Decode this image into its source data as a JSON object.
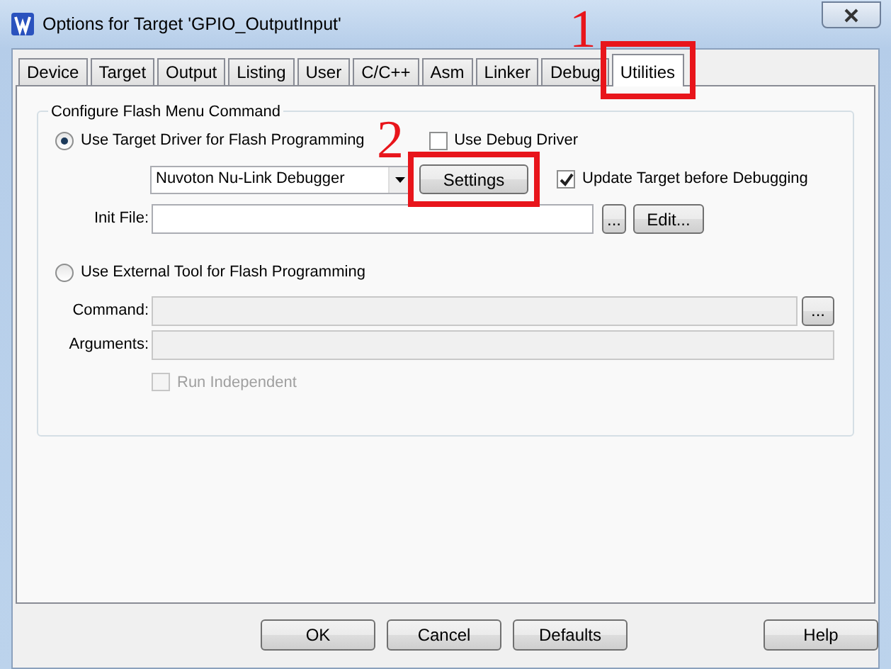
{
  "window": {
    "title": "Options for Target 'GPIO_OutputInput'"
  },
  "tabs": [
    {
      "label": "Device",
      "selected": false
    },
    {
      "label": "Target",
      "selected": false
    },
    {
      "label": "Output",
      "selected": false
    },
    {
      "label": "Listing",
      "selected": false
    },
    {
      "label": "User",
      "selected": false
    },
    {
      "label": "C/C++",
      "selected": false
    },
    {
      "label": "Asm",
      "selected": false
    },
    {
      "label": "Linker",
      "selected": false
    },
    {
      "label": "Debug",
      "selected": false
    },
    {
      "label": "Utilities",
      "selected": true
    }
  ],
  "flash_group": {
    "legend": "Configure Flash Menu Command",
    "target_driver": {
      "label": "Use Target Driver for Flash Programming",
      "selected": true,
      "driver": "Nuvoton Nu-Link Debugger",
      "settings_button": "Settings",
      "use_debug_driver": {
        "label": "Use Debug Driver",
        "checked": false
      },
      "update_target": {
        "label": "Update Target before Debugging",
        "checked": true
      },
      "init_file": {
        "label": "Init File:",
        "browse": "...",
        "edit": "Edit..."
      }
    },
    "external_tool": {
      "label": "Use External Tool for Flash Programming",
      "selected": false,
      "command": {
        "label": "Command:",
        "browse": "..."
      },
      "arguments": {
        "label": "Arguments:"
      },
      "run_independent": {
        "label": "Run Independent",
        "checked": false,
        "disabled": true
      }
    }
  },
  "buttons": [
    {
      "label": "OK"
    },
    {
      "label": "Cancel"
    },
    {
      "label": "Defaults"
    },
    {
      "label": "Help"
    }
  ],
  "annotations": [
    {
      "number": "1",
      "kind": "tab"
    },
    {
      "number": "2",
      "kind": "settings"
    }
  ]
}
